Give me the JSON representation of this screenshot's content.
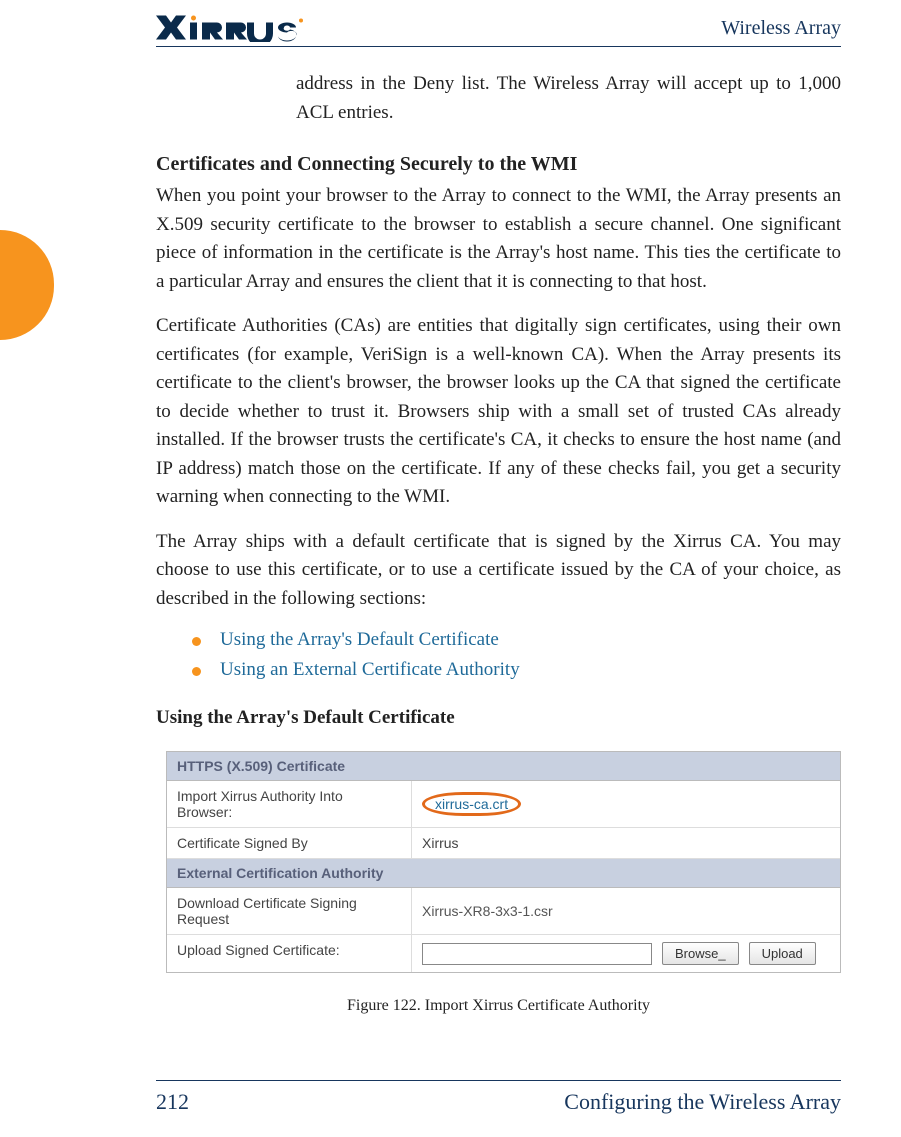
{
  "header": {
    "product": "Wireless Array"
  },
  "lead": "address in the Deny list. The Wireless Array will accept up to 1,000 ACL entries.",
  "sec1": {
    "title": "Certificates and Connecting Securely to the WMI",
    "p1": "When you point your browser to the Array to connect to the WMI, the Array presents an X.509 security certificate to the browser to establish a secure channel. One significant piece of information in the certificate is the Array's host name. This ties the certificate to a particular Array and ensures the client that it is connecting to that host.",
    "p2": "Certificate Authorities (CAs) are entities that digitally sign certificates, using their own certificates (for example, VeriSign is a well-known CA). When the Array presents its certificate to the client's browser, the browser looks up the CA that signed the certificate to decide whether to trust it. Browsers ship with a small set of trusted CAs already installed. If the browser trusts the certificate's CA, it checks to ensure the host name (and IP address) match those on the certificate. If any of these checks fail, you get a security warning when connecting to the WMI.",
    "p3": "The Array ships with a default certificate that is signed by the Xirrus CA. You may choose to use this certificate, or to use a certificate issued by the CA of your choice, as described in the following sections:"
  },
  "bullets": {
    "b1": "Using the Array's Default Certificate",
    "b2": "Using an External Certificate Authority"
  },
  "sec2": {
    "title": "Using the Array's Default Certificate"
  },
  "figure": {
    "s1": "HTTPS (X.509) Certificate",
    "r1l": "Import Xirrus Authority Into Browser:",
    "r1r": "xirrus-ca.crt",
    "r2l": "Certificate Signed By",
    "r2r": "Xirrus",
    "s2": "External Certification Authority",
    "r3l": "Download Certificate Signing Request",
    "r3r": "Xirrus-XR8-3x3-1.csr",
    "r4l": "Upload Signed Certificate:",
    "browse": "Browse_",
    "upload": "Upload"
  },
  "caption": "Figure 122. Import Xirrus Certificate Authority",
  "footer": {
    "page": "212",
    "title": "Configuring the Wireless Array"
  }
}
